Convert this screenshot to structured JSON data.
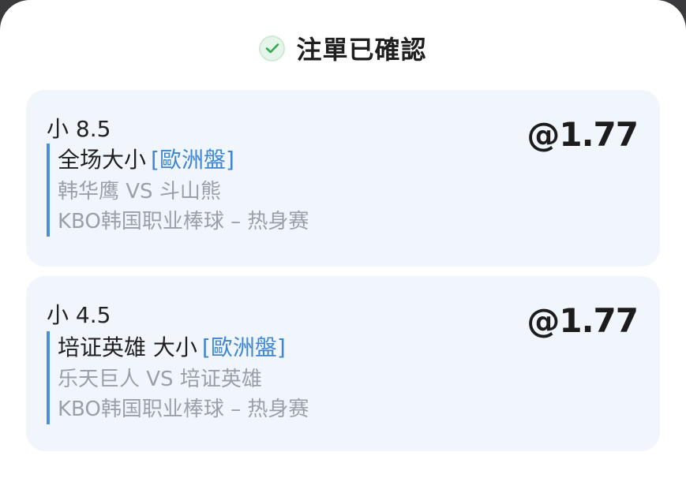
{
  "header": {
    "title": "注單已確認"
  },
  "bets": [
    {
      "selection": "小 8.5",
      "market": "全场大小",
      "market_tag": "[歐洲盤]",
      "match": "韩华鹰 VS 斗山熊",
      "league": "KBO韩国职业棒球 – 热身赛",
      "odds": "@1.77"
    },
    {
      "selection": "小 4.5",
      "market": "培证英雄 大小",
      "market_tag": "[歐洲盤]",
      "match": "乐天巨人 VS 培证英雄",
      "league": "KBO韩国职业棒球 – 热身赛",
      "odds": "@1.77"
    }
  ],
  "colors": {
    "accent": "#3d86d6",
    "check": "#34a853",
    "card_bg": "#f1f6fc",
    "muted_text": "#9aa0a8"
  }
}
